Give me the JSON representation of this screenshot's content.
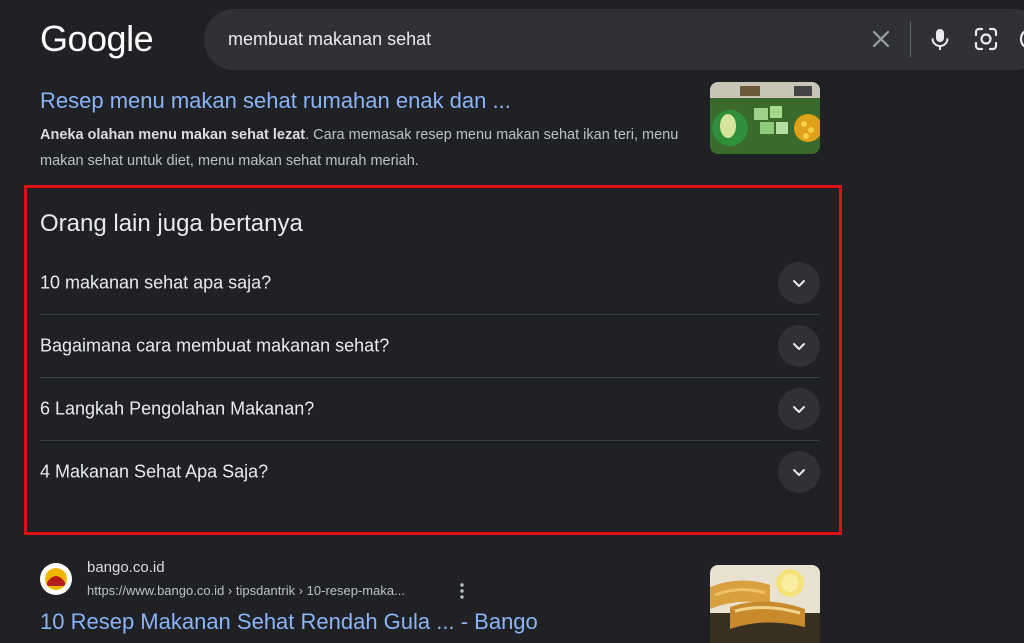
{
  "header": {
    "logo": "Google",
    "search_query": "membuat makanan sehat"
  },
  "result1": {
    "title": "Resep menu makan sehat rumahan enak dan ...",
    "snippet_bold": "Aneka olahan menu makan sehat lezat",
    "snippet_rest": ". Cara memasak resep menu makan sehat ikan teri, menu makan sehat untuk diet, menu makan sehat murah meriah."
  },
  "paa": {
    "heading": "Orang lain juga bertanya",
    "questions": [
      "10 makanan sehat apa saja?",
      "Bagaimana cara membuat makanan sehat?",
      "6 Langkah Pengolahan Makanan?",
      "4 Makanan Sehat Apa Saja?"
    ]
  },
  "result2": {
    "site_name": "bango.co.id",
    "url": "https://www.bango.co.id › tipsdantrik › 10-resep-maka...",
    "title": "10 Resep Makanan Sehat Rendah Gula ... - Bango"
  },
  "colors": {
    "background": "#202124",
    "link": "#8ab4f8",
    "highlight_border": "#e0101a"
  }
}
